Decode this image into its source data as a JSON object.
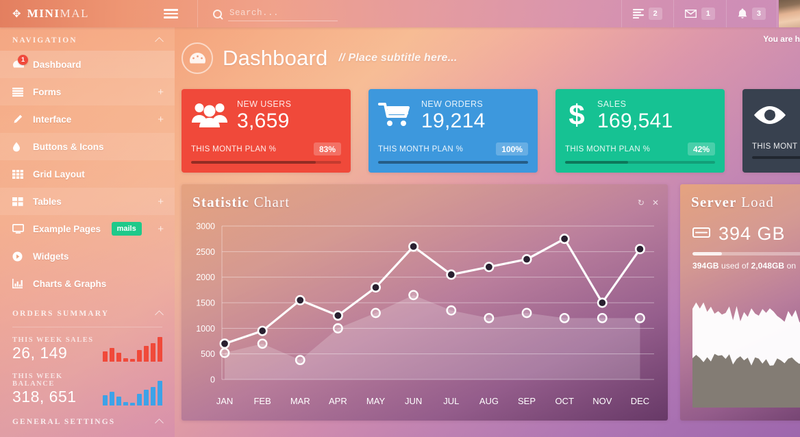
{
  "brand": {
    "mark": "move-icon",
    "bold": "MINI",
    "light": "MAL"
  },
  "topbar": {
    "hamburger_label": "menu-toggle",
    "search": {
      "placeholder": "Search...",
      "value": "",
      "icon": "search-icon"
    },
    "items": [
      {
        "icon": "tasks-icon",
        "count": "2"
      },
      {
        "icon": "envelope-icon",
        "count": "1"
      },
      {
        "icon": "bell-icon",
        "count": "3"
      }
    ]
  },
  "sidebar": {
    "nav_header": "NAVIGATION",
    "items": [
      {
        "label": "Dashboard",
        "icon": "dashboard-icon",
        "badge": "1",
        "plus": false,
        "state": "active"
      },
      {
        "label": "Forms",
        "icon": "list-icon",
        "badge": null,
        "plus": true,
        "state": "hl"
      },
      {
        "label": "Interface",
        "icon": "pencil-icon",
        "badge": null,
        "plus": true,
        "state": ""
      },
      {
        "label": "Buttons & Icons",
        "icon": "droplet-icon",
        "badge": null,
        "plus": false,
        "state": "hl"
      },
      {
        "label": "Grid Layout",
        "icon": "grid-icon",
        "badge": null,
        "plus": false,
        "state": ""
      },
      {
        "label": "Tables",
        "icon": "table-icon",
        "badge": null,
        "plus": true,
        "state": "hl"
      },
      {
        "label": "Example Pages",
        "icon": "monitor-icon",
        "badge": null,
        "plus": true,
        "state": "",
        "pill": "mails"
      },
      {
        "label": "Widgets",
        "icon": "play-icon",
        "badge": null,
        "plus": false,
        "state": ""
      },
      {
        "label": "Charts & Graphs",
        "icon": "barchart-icon",
        "badge": null,
        "plus": false,
        "state": ""
      }
    ],
    "orders_header": "ORDERS SUMMARY",
    "summary": [
      {
        "label": "THIS WEEK SALES",
        "value": "26, 149",
        "color": "#f0493a"
      },
      {
        "label": "THIS WEEK BALANCE",
        "value": "318, 651",
        "color": "#3da2e8"
      }
    ],
    "settings_header": "GENERAL SETTINGS"
  },
  "page": {
    "you_are_here": "You are h",
    "title": "Dashboard",
    "subtitle": "// Place subtitle here...",
    "icon": "dashboard-gauge-icon"
  },
  "cards": [
    {
      "caption": "NEW USERS",
      "value": "3,659",
      "plan_label": "THIS MONTH PLAN %",
      "percent": "83%",
      "fill": 83,
      "color": "#f0493a",
      "icon": "users-icon"
    },
    {
      "caption": "NEW ORDERS",
      "value": "19,214",
      "plan_label": "THIS MONTH PLAN %",
      "percent": "100%",
      "fill": 100,
      "color": "#3d98dd",
      "icon": "cart-icon"
    },
    {
      "caption": "SALES",
      "value": "169,541",
      "plan_label": "THIS MONTH PLAN %",
      "percent": "42%",
      "fill": 42,
      "color": "#16c293",
      "icon": "dollar-icon"
    },
    {
      "caption": "",
      "value": "",
      "plan_label": "THIS MONT",
      "percent": "",
      "fill": 35,
      "color": "#38414f",
      "icon": "eye-icon"
    }
  ],
  "chart_panel": {
    "title_bold": "Statistic",
    "title_light": "Chart",
    "tools": [
      "refresh-icon",
      "close-icon"
    ]
  },
  "chart_data": {
    "type": "line",
    "title": "Statistic Chart",
    "categories": [
      "JAN",
      "FEB",
      "MAR",
      "APR",
      "MAY",
      "JUN",
      "JUL",
      "AUG",
      "SEP",
      "OCT",
      "NOV",
      "DEC"
    ],
    "series": [
      {
        "name": "line-series",
        "values": [
          700,
          950,
          1550,
          1250,
          1800,
          2600,
          2050,
          2200,
          2350,
          2750,
          1500,
          2550
        ]
      },
      {
        "name": "area-series",
        "values": [
          520,
          700,
          380,
          1000,
          1300,
          1650,
          1350,
          1200,
          1300,
          1200,
          1200,
          1200
        ]
      }
    ],
    "ylim": [
      0,
      3000
    ],
    "yticks": [
      0,
      500,
      1000,
      1500,
      2000,
      2500,
      3000
    ],
    "xlabel": "",
    "ylabel": "",
    "grid": true,
    "legend": "none"
  },
  "server_panel": {
    "title_bold": "Server",
    "title_light": "Load",
    "disk_icon": "hdd-icon",
    "disk_value": "394 GB",
    "used_bold": "394GB",
    "used_mid": " used of ",
    "total_bold": "2,048GB",
    "used_tail": " on"
  }
}
